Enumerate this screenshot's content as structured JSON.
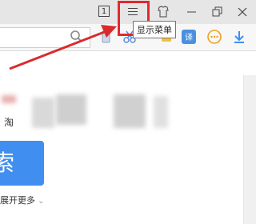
{
  "titlebar": {
    "tab_count": "1",
    "menu_tooltip": "显示菜单"
  },
  "content": {
    "partial_char_1": "淘",
    "search_button_partial": "索",
    "expand_more_label": "展开更多"
  },
  "colors": {
    "highlight": "#e4272f",
    "arrow": "#d92b2b",
    "search_button": "#3f8ef0",
    "toolbar_accent": "#f0a020",
    "translate_icon": "#4a90e2"
  },
  "icons": [
    "tab-count-icon",
    "menu-icon",
    "skin-icon",
    "minimize-icon",
    "restore-icon",
    "close-icon",
    "search-icon",
    "phone-icon",
    "scissors-icon",
    "translate-icon",
    "more-icon",
    "download-icon"
  ]
}
